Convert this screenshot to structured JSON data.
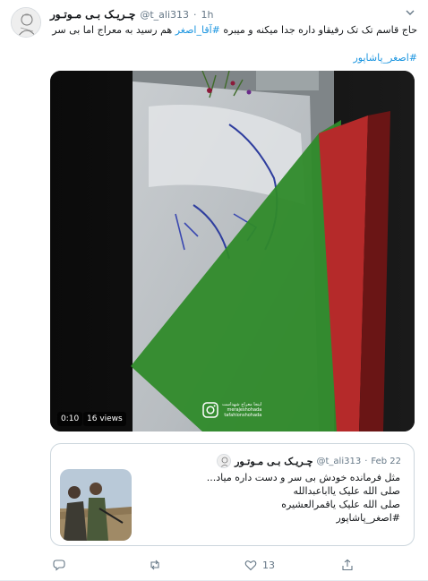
{
  "tweet": {
    "display_name": "چـریـک بـی مـوتـور",
    "handle": "@t_ali313",
    "dot": "·",
    "time": "1h",
    "text_before_mention": "حاج قاسم تک تک رفیقاو داره جدا میکنه و میبره ",
    "mention": "#آقا_اصغر",
    "text_after_mention": " هم رسید به معراج اما بی سر",
    "hashtag": "#اصغر_پاشاپور"
  },
  "video": {
    "elapsed": "0:10",
    "views": "16 views",
    "watermark_line1": "اینجا معراج شهداست",
    "watermark_line2": "merajeshohada",
    "watermark_line3": "tafahionshohada"
  },
  "quoted_tweet": {
    "display_name": "چـریـک بـی مـوتـور",
    "handle": "@t_ali313",
    "dot": "·",
    "date": "Feb 22",
    "lines": [
      "مثل فرمانده خودش بی سر و دست داره میاد...",
      "صلی الله علیک یااباعبدالله",
      "صلی الله علیک یاقمرالعشیره",
      "#اصغر_پاشاپور"
    ]
  },
  "actions": {
    "reply_icon": "reply-icon",
    "retweet_icon": "retweet-icon",
    "like_icon": "heart-icon",
    "like_count": "13",
    "share_icon": "share-icon"
  },
  "colors": {
    "link": "#1b95e0",
    "secondary": "#657786",
    "border": "#ccd6dd"
  }
}
